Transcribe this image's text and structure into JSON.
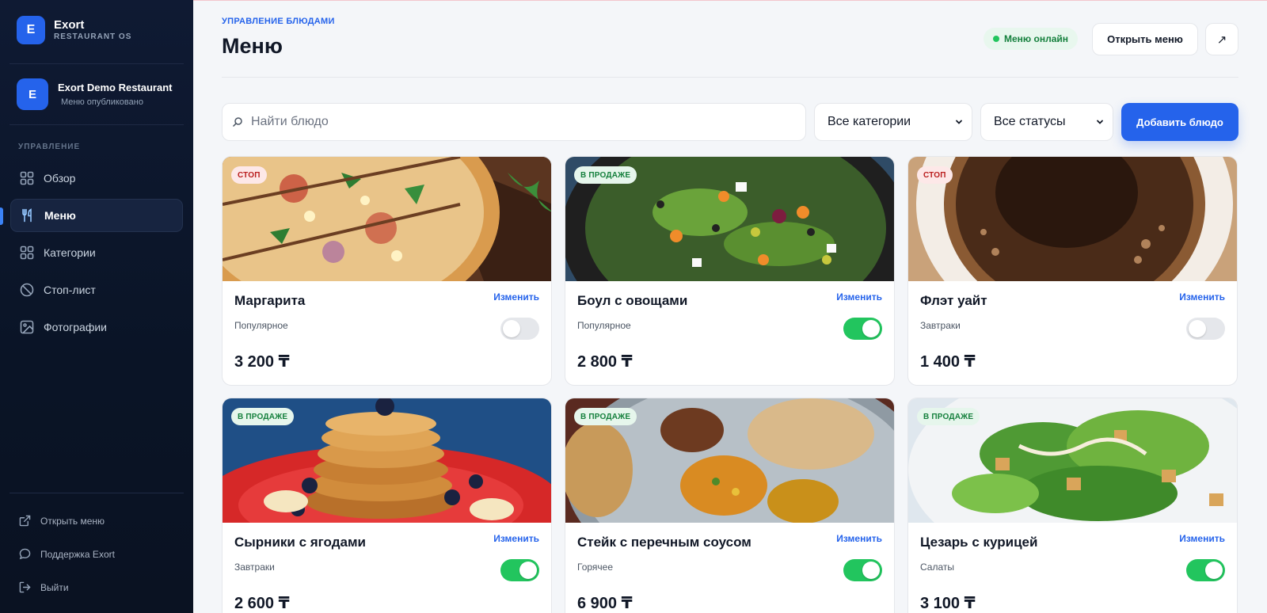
{
  "sidebar": {
    "brand": {
      "initial": "E",
      "name": "Exort",
      "sub": "RESTAURANT OS"
    },
    "restaurant": {
      "initial": "E",
      "name": "Exort Demo Restaurant",
      "status": "Меню опубликовано"
    },
    "section_label": "УПРАВЛЕНИЕ",
    "nav": [
      {
        "label": "Обзор",
        "icon": "grid-icon"
      },
      {
        "label": "Меню",
        "icon": "utensils-icon",
        "active": true
      },
      {
        "label": "Категории",
        "icon": "grid-icon"
      },
      {
        "label": "Стоп-лист",
        "icon": "ban-icon"
      },
      {
        "label": "Фотографии",
        "icon": "image-icon"
      }
    ],
    "footer": [
      {
        "label": "Открыть меню",
        "icon": "external-link-icon"
      },
      {
        "label": "Поддержка Exort",
        "icon": "chat-icon"
      },
      {
        "label": "Выйти",
        "icon": "logout-icon"
      }
    ]
  },
  "header": {
    "eyebrow": "УПРАВЛЕНИЕ БЛЮДАМИ",
    "title": "Меню",
    "status": "Меню онлайн",
    "open_menu": "Открыть меню",
    "external": "↗"
  },
  "toolbar": {
    "search_placeholder": "Найти блюдо",
    "category_select": "Все категории",
    "status_select": "Все статусы",
    "add_button": "Добавить блюдо"
  },
  "dishes": [
    {
      "name": "Маргарита",
      "category": "Популярное",
      "price": "3 200 ₸",
      "badge": "СТОП",
      "badge_type": "stop",
      "enabled": false,
      "edit": "Изменить",
      "photo": "pizza"
    },
    {
      "name": "Боул с овощами",
      "category": "Популярное",
      "price": "2 800 ₸",
      "badge": "В ПРОДАЖЕ",
      "badge_type": "sale",
      "enabled": true,
      "edit": "Изменить",
      "photo": "salad"
    },
    {
      "name": "Флэт уайт",
      "category": "Завтраки",
      "price": "1 400 ₸",
      "badge": "СТОП",
      "badge_type": "stop",
      "enabled": false,
      "edit": "Изменить",
      "photo": "coffee"
    },
    {
      "name": "Сырники с ягодами",
      "category": "Завтраки",
      "price": "2 600 ₸",
      "badge": "В ПРОДАЖЕ",
      "badge_type": "sale",
      "enabled": true,
      "edit": "Изменить",
      "photo": "pancakes"
    },
    {
      "name": "Стейк с перечным соусом",
      "category": "Горячее",
      "price": "6 900 ₸",
      "badge": "В ПРОДАЖЕ",
      "badge_type": "sale",
      "enabled": true,
      "edit": "Изменить",
      "photo": "thali"
    },
    {
      "name": "Цезарь с курицей",
      "category": "Салаты",
      "price": "3 100 ₸",
      "badge": "В ПРОДАЖЕ",
      "badge_type": "sale",
      "enabled": true,
      "edit": "Изменить",
      "photo": "caesar"
    }
  ],
  "colors": {
    "accent": "#2563eb",
    "sidebar_bg": "#0f1a33",
    "success": "#22c55e",
    "danger": "#b91c1c"
  }
}
